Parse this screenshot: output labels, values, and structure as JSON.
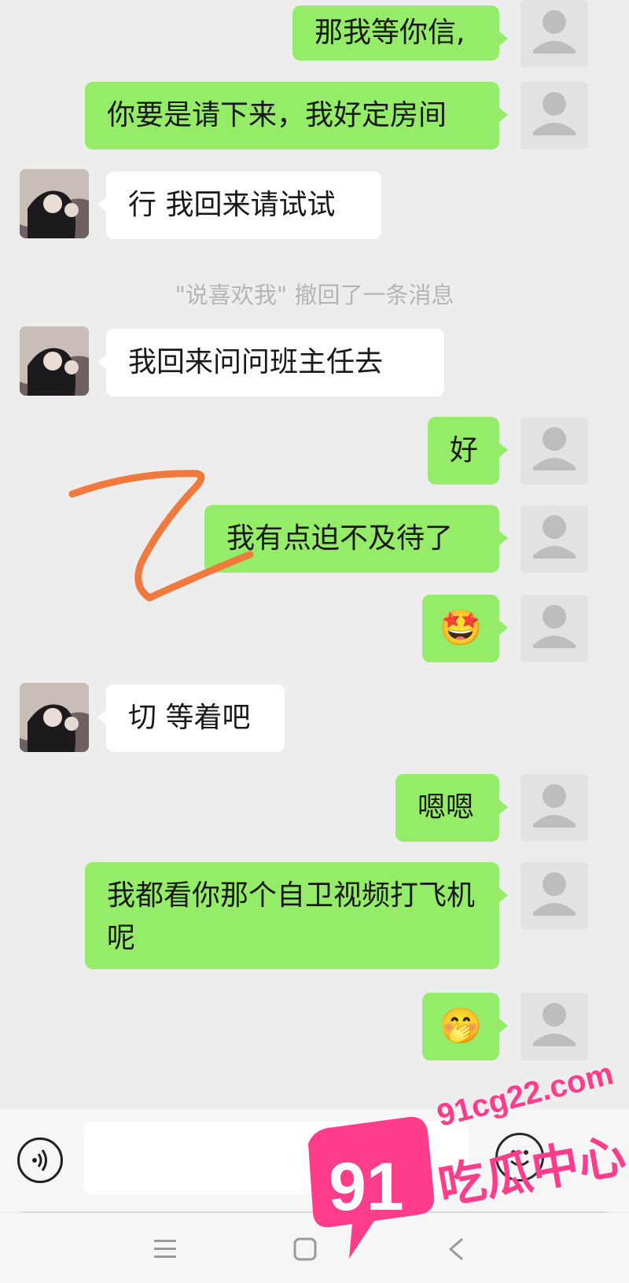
{
  "messages": [
    {
      "dir": "out",
      "text": "那我等你信,"
    },
    {
      "dir": "out",
      "text": "你要是请下来，我好定房间"
    },
    {
      "dir": "in",
      "text": "行 我回来请试试"
    },
    {
      "dir": "in",
      "text": "我回来问问班主任去"
    },
    {
      "dir": "out",
      "text": "好"
    },
    {
      "dir": "out",
      "text": "我有点迫不及待了"
    },
    {
      "dir": "out",
      "emoji": "🤩"
    },
    {
      "dir": "in",
      "text": "切 等着吧"
    },
    {
      "dir": "out",
      "text": "嗯嗯"
    },
    {
      "dir": "out",
      "text": "我都看你那个自卫视频打飞机呢"
    },
    {
      "dir": "out",
      "emoji": "🤭"
    }
  ],
  "recall_notice": "\"说喜欢我\" 撤回了一条消息",
  "input": {
    "value": "",
    "placeholder": ""
  },
  "icons": {
    "voice": "voice-icon",
    "emoji": "emoji-icon",
    "avatar_default": "default-avatar-icon",
    "nav_menu": "menu-icon",
    "nav_home": "home-icon",
    "nav_back": "back-icon"
  },
  "watermark": {
    "domain": "91cg22.com",
    "badge": "91",
    "brand": "吃瓜中心"
  },
  "colors": {
    "background": "#ededed",
    "outgoing_bubble": "#95ec69",
    "incoming_bubble": "#ffffff",
    "recall_text": "#b5b5b5",
    "scribble": "#f07a3e",
    "watermark": "#ff3d8b"
  }
}
